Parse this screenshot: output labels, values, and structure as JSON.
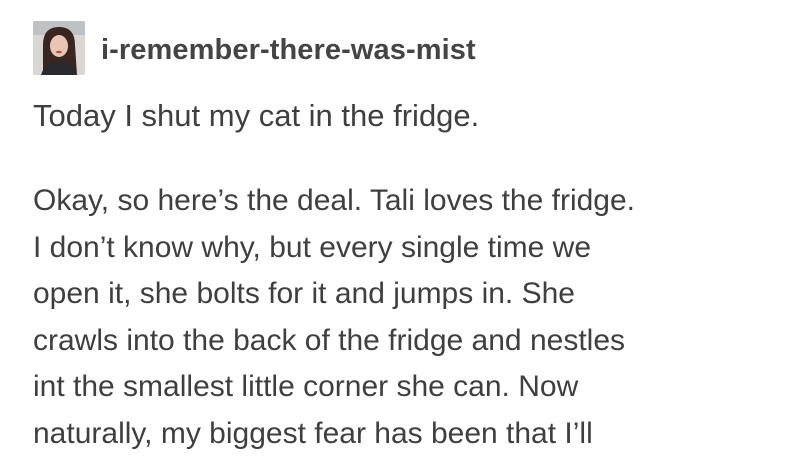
{
  "post": {
    "author": {
      "username": "i-remember-there-was-mist",
      "avatar_icon": "user-avatar"
    },
    "title": "Today I shut my cat in the fridge.",
    "body_lines": [
      "Okay, so here’s the deal.  Tali loves the fridge.",
      " I don’t know why, but every single time we",
      "open it, she bolts for it and jumps in.  She",
      "crawls into the back of the fridge and nestles",
      "int the smallest little corner she can.  Now",
      "naturally, my biggest fear has been that I’ll"
    ]
  }
}
